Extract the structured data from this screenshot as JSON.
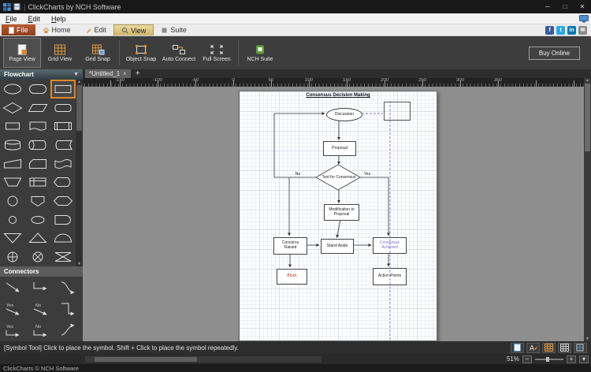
{
  "colors": {
    "accent_orange": "#e0862e",
    "file_tab": "#9a451f",
    "selected_tab_tan": "#d8c07a",
    "guide_purple": "#8276e2",
    "achieved_text": "#7a6fd4",
    "block_text": "#cc3311",
    "suite_green": "#5f9e3e"
  },
  "titlebar": {
    "title": "ClickCharts by NCH Software",
    "controls": {
      "minimize": "─",
      "maximize": "□",
      "close": "✕"
    }
  },
  "menubar": {
    "items": [
      "File",
      "Edit",
      "Help"
    ]
  },
  "ribbon": {
    "tabs": [
      {
        "label": "File"
      },
      {
        "label": "Home"
      },
      {
        "label": "Edit"
      },
      {
        "label": "View"
      },
      {
        "label": "Suite"
      }
    ],
    "selected": "View"
  },
  "toolbar": {
    "buttons": [
      {
        "label": "Page View"
      },
      {
        "label": "Grid View"
      },
      {
        "label": "Grid Snap"
      },
      {
        "label": "Object Snap"
      },
      {
        "label": "Auto Connect"
      },
      {
        "label": "Full Screen"
      },
      {
        "label": "NCH Suite"
      }
    ],
    "buy_online": "Buy Online"
  },
  "sidebar": {
    "flowchart_header": "Flowchart",
    "connectors_header": "Connectors",
    "shapes": [
      "terminator",
      "rounded-rectangle",
      "rectangle",
      "decision-diamond",
      "data-parallelogram",
      "alternate-process",
      "process",
      "document",
      "predefined-process",
      "magnetic-disk",
      "direct-access-storage",
      "stored-data",
      "manual-input",
      "card",
      "punched-tape",
      "manual-operation",
      "internal-storage",
      "display",
      "connector-circle",
      "off-page-connector",
      "preparation-hexagon",
      "small-circle",
      "small-ellipse",
      "delay",
      "merge-triangle",
      "extract-triangle",
      "semicircle",
      "or-junction",
      "summing-junction",
      "collate"
    ],
    "selected_shape": "rectangle",
    "connector_labels": {
      "yes": "Yes",
      "no": "No"
    }
  },
  "document": {
    "tab_title": "*Untitled_1",
    "close_glyph": "×",
    "new_tab_glyph": "+"
  },
  "ruler": {
    "labels": [
      "-150",
      "-100",
      "-50",
      "0",
      "50",
      "100",
      "150",
      "200",
      "250",
      "300",
      "350"
    ]
  },
  "flowchart": {
    "title": "Consensus Decision Making",
    "nodes": [
      {
        "label": "Discussion"
      },
      {
        "label": "Proposal"
      },
      {
        "label": "Test for Consensus"
      },
      {
        "label": "Modification to Proposal"
      },
      {
        "label": "Concerns Raised"
      },
      {
        "label": "Stand Aside"
      },
      {
        "label": "Consensus Achieved"
      },
      {
        "label": "Block"
      },
      {
        "label": "Action Points"
      }
    ],
    "edge_labels": {
      "yes": "Yes",
      "no": "No"
    }
  },
  "statusbar": {
    "message": "[Symbol Tool] Click to place the symbol.  Shift + Click to place the symbol repeatedly."
  },
  "zoom": {
    "level": "51%",
    "minus_glyph": "−",
    "plus_glyph": "+"
  },
  "footer": {
    "text": "ClickCharts © NCH Software"
  }
}
